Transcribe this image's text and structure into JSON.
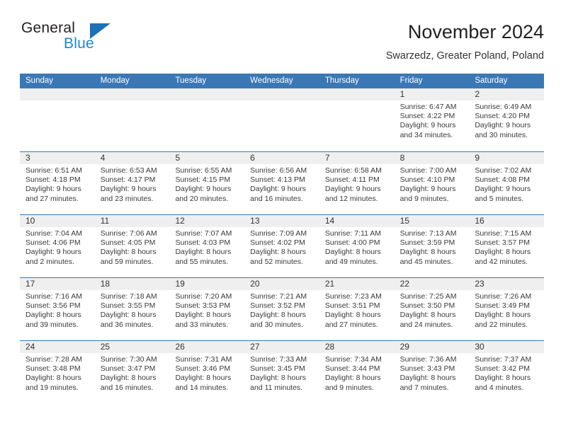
{
  "brand": {
    "name_part1": "General",
    "name_part2": "Blue",
    "triangle_color": "#1b70b8",
    "blue_text_color": "#1b86d8"
  },
  "header": {
    "title": "November 2024",
    "subtitle": "Swarzedz, Greater Poland, Poland"
  },
  "theme": {
    "header_blue": "#3a78b5",
    "date_band_gray": "#efefef"
  },
  "weekday_headers": [
    "Sunday",
    "Monday",
    "Tuesday",
    "Wednesday",
    "Thursday",
    "Friday",
    "Saturday"
  ],
  "weeks": [
    [
      {
        "date": "",
        "empty": true
      },
      {
        "date": "",
        "empty": true
      },
      {
        "date": "",
        "empty": true
      },
      {
        "date": "",
        "empty": true
      },
      {
        "date": "",
        "empty": true
      },
      {
        "date": "1",
        "sunrise": "Sunrise: 6:47 AM",
        "sunset": "Sunset: 4:22 PM",
        "daylight1": "Daylight: 9 hours",
        "daylight2": "and 34 minutes."
      },
      {
        "date": "2",
        "sunrise": "Sunrise: 6:49 AM",
        "sunset": "Sunset: 4:20 PM",
        "daylight1": "Daylight: 9 hours",
        "daylight2": "and 30 minutes."
      }
    ],
    [
      {
        "date": "3",
        "sunrise": "Sunrise: 6:51 AM",
        "sunset": "Sunset: 4:18 PM",
        "daylight1": "Daylight: 9 hours",
        "daylight2": "and 27 minutes."
      },
      {
        "date": "4",
        "sunrise": "Sunrise: 6:53 AM",
        "sunset": "Sunset: 4:17 PM",
        "daylight1": "Daylight: 9 hours",
        "daylight2": "and 23 minutes."
      },
      {
        "date": "5",
        "sunrise": "Sunrise: 6:55 AM",
        "sunset": "Sunset: 4:15 PM",
        "daylight1": "Daylight: 9 hours",
        "daylight2": "and 20 minutes."
      },
      {
        "date": "6",
        "sunrise": "Sunrise: 6:56 AM",
        "sunset": "Sunset: 4:13 PM",
        "daylight1": "Daylight: 9 hours",
        "daylight2": "and 16 minutes."
      },
      {
        "date": "7",
        "sunrise": "Sunrise: 6:58 AM",
        "sunset": "Sunset: 4:11 PM",
        "daylight1": "Daylight: 9 hours",
        "daylight2": "and 12 minutes."
      },
      {
        "date": "8",
        "sunrise": "Sunrise: 7:00 AM",
        "sunset": "Sunset: 4:10 PM",
        "daylight1": "Daylight: 9 hours",
        "daylight2": "and 9 minutes."
      },
      {
        "date": "9",
        "sunrise": "Sunrise: 7:02 AM",
        "sunset": "Sunset: 4:08 PM",
        "daylight1": "Daylight: 9 hours",
        "daylight2": "and 5 minutes."
      }
    ],
    [
      {
        "date": "10",
        "sunrise": "Sunrise: 7:04 AM",
        "sunset": "Sunset: 4:06 PM",
        "daylight1": "Daylight: 9 hours",
        "daylight2": "and 2 minutes."
      },
      {
        "date": "11",
        "sunrise": "Sunrise: 7:06 AM",
        "sunset": "Sunset: 4:05 PM",
        "daylight1": "Daylight: 8 hours",
        "daylight2": "and 59 minutes."
      },
      {
        "date": "12",
        "sunrise": "Sunrise: 7:07 AM",
        "sunset": "Sunset: 4:03 PM",
        "daylight1": "Daylight: 8 hours",
        "daylight2": "and 55 minutes."
      },
      {
        "date": "13",
        "sunrise": "Sunrise: 7:09 AM",
        "sunset": "Sunset: 4:02 PM",
        "daylight1": "Daylight: 8 hours",
        "daylight2": "and 52 minutes."
      },
      {
        "date": "14",
        "sunrise": "Sunrise: 7:11 AM",
        "sunset": "Sunset: 4:00 PM",
        "daylight1": "Daylight: 8 hours",
        "daylight2": "and 49 minutes."
      },
      {
        "date": "15",
        "sunrise": "Sunrise: 7:13 AM",
        "sunset": "Sunset: 3:59 PM",
        "daylight1": "Daylight: 8 hours",
        "daylight2": "and 45 minutes."
      },
      {
        "date": "16",
        "sunrise": "Sunrise: 7:15 AM",
        "sunset": "Sunset: 3:57 PM",
        "daylight1": "Daylight: 8 hours",
        "daylight2": "and 42 minutes."
      }
    ],
    [
      {
        "date": "17",
        "sunrise": "Sunrise: 7:16 AM",
        "sunset": "Sunset: 3:56 PM",
        "daylight1": "Daylight: 8 hours",
        "daylight2": "and 39 minutes."
      },
      {
        "date": "18",
        "sunrise": "Sunrise: 7:18 AM",
        "sunset": "Sunset: 3:55 PM",
        "daylight1": "Daylight: 8 hours",
        "daylight2": "and 36 minutes."
      },
      {
        "date": "19",
        "sunrise": "Sunrise: 7:20 AM",
        "sunset": "Sunset: 3:53 PM",
        "daylight1": "Daylight: 8 hours",
        "daylight2": "and 33 minutes."
      },
      {
        "date": "20",
        "sunrise": "Sunrise: 7:21 AM",
        "sunset": "Sunset: 3:52 PM",
        "daylight1": "Daylight: 8 hours",
        "daylight2": "and 30 minutes."
      },
      {
        "date": "21",
        "sunrise": "Sunrise: 7:23 AM",
        "sunset": "Sunset: 3:51 PM",
        "daylight1": "Daylight: 8 hours",
        "daylight2": "and 27 minutes."
      },
      {
        "date": "22",
        "sunrise": "Sunrise: 7:25 AM",
        "sunset": "Sunset: 3:50 PM",
        "daylight1": "Daylight: 8 hours",
        "daylight2": "and 24 minutes."
      },
      {
        "date": "23",
        "sunrise": "Sunrise: 7:26 AM",
        "sunset": "Sunset: 3:49 PM",
        "daylight1": "Daylight: 8 hours",
        "daylight2": "and 22 minutes."
      }
    ],
    [
      {
        "date": "24",
        "sunrise": "Sunrise: 7:28 AM",
        "sunset": "Sunset: 3:48 PM",
        "daylight1": "Daylight: 8 hours",
        "daylight2": "and 19 minutes."
      },
      {
        "date": "25",
        "sunrise": "Sunrise: 7:30 AM",
        "sunset": "Sunset: 3:47 PM",
        "daylight1": "Daylight: 8 hours",
        "daylight2": "and 16 minutes."
      },
      {
        "date": "26",
        "sunrise": "Sunrise: 7:31 AM",
        "sunset": "Sunset: 3:46 PM",
        "daylight1": "Daylight: 8 hours",
        "daylight2": "and 14 minutes."
      },
      {
        "date": "27",
        "sunrise": "Sunrise: 7:33 AM",
        "sunset": "Sunset: 3:45 PM",
        "daylight1": "Daylight: 8 hours",
        "daylight2": "and 11 minutes."
      },
      {
        "date": "28",
        "sunrise": "Sunrise: 7:34 AM",
        "sunset": "Sunset: 3:44 PM",
        "daylight1": "Daylight: 8 hours",
        "daylight2": "and 9 minutes."
      },
      {
        "date": "29",
        "sunrise": "Sunrise: 7:36 AM",
        "sunset": "Sunset: 3:43 PM",
        "daylight1": "Daylight: 8 hours",
        "daylight2": "and 7 minutes."
      },
      {
        "date": "30",
        "sunrise": "Sunrise: 7:37 AM",
        "sunset": "Sunset: 3:42 PM",
        "daylight1": "Daylight: 8 hours",
        "daylight2": "and 4 minutes."
      }
    ]
  ]
}
